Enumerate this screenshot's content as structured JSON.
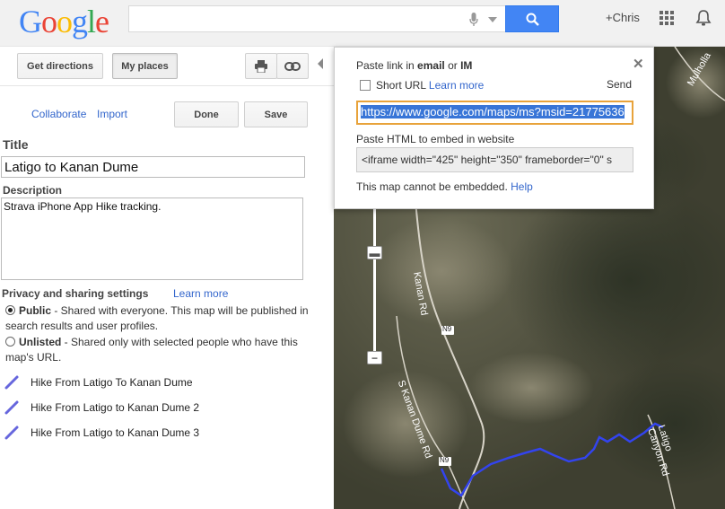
{
  "header": {
    "logo_letters": [
      {
        "ch": "G",
        "color": "#4285f4"
      },
      {
        "ch": "o",
        "color": "#ea4335"
      },
      {
        "ch": "o",
        "color": "#fbbc05"
      },
      {
        "ch": "g",
        "color": "#4285f4"
      },
      {
        "ch": "l",
        "color": "#34a853"
      },
      {
        "ch": "e",
        "color": "#ea4335"
      }
    ],
    "search_value": "",
    "user_label": "+Chris"
  },
  "toolbar": {
    "directions_label": "Get directions",
    "my_places_label": "My places",
    "print_icon": "print-icon",
    "link_icon": "link-icon"
  },
  "actions": {
    "collaborate_label": "Collaborate",
    "import_label": "Import",
    "done_label": "Done",
    "save_label": "Save"
  },
  "form": {
    "title_label": "Title",
    "title_value": "Latigo to Kanan Dume",
    "description_label": "Description",
    "description_value": "Strava iPhone App Hike tracking."
  },
  "privacy": {
    "heading": "Privacy and sharing settings",
    "learn_more": "Learn more",
    "public_title": "Public",
    "public_desc": " - Shared with everyone. This map will be published in search results and user profiles.",
    "unlisted_title": "Unlisted",
    "unlisted_desc": " - Shared only with selected people who have this map's URL.",
    "selected": "public"
  },
  "layers": [
    {
      "label": "Hike From Latigo To Kanan Dume"
    },
    {
      "label": "Hike From Latigo to Kanan Dume 2"
    },
    {
      "label": "Hike From Latigo to Kanan Dume 3"
    }
  ],
  "share_popup": {
    "paste_link_prefix": "Paste link in ",
    "paste_link_email": "email",
    "paste_link_or": " or ",
    "paste_link_im": "IM",
    "short_url_label": "Short URL",
    "learn_more": "Learn more",
    "send_label": "Send",
    "url_value": "https://www.google.com/maps/ms?msid=21775636",
    "embed_label": "Paste HTML to embed in website",
    "embed_value": "<iframe width=\"425\" height=\"350\" frameborder=\"0\" s",
    "cannot_embed": "This map cannot be embedded.",
    "help_label": "Help"
  },
  "map": {
    "road_labels": [
      "Kanan Rd",
      "N9",
      "S Kanan Dume Rd",
      "N9",
      "Latigo Canyon Rd",
      "Mulholla"
    ],
    "route_color": "#3344ee"
  }
}
